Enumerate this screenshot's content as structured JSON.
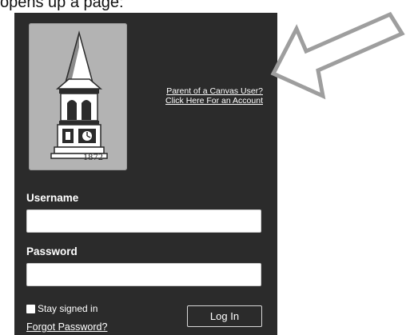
{
  "caption": {
    "text": "opens up a page:"
  },
  "logo": {
    "year": "1872",
    "icon": "clock-tower-icon"
  },
  "parent_links": {
    "line1": "Parent of a Canvas User?",
    "line2": "Click Here For an Account"
  },
  "form": {
    "username_label": "Username",
    "username_value": "",
    "password_label": "Password",
    "password_value": "",
    "stay_signed_in_label": "Stay signed in",
    "stay_signed_in_checked": false,
    "forgot_password_label": "Forgot Password?",
    "login_button_label": "Log In"
  },
  "annotation": {
    "icon": "arrow-icon",
    "color": "#9e9e9e"
  },
  "colors": {
    "panel": "#2b2b2b",
    "logo_bg": "#b3b3b3",
    "text": "#ffffff"
  }
}
